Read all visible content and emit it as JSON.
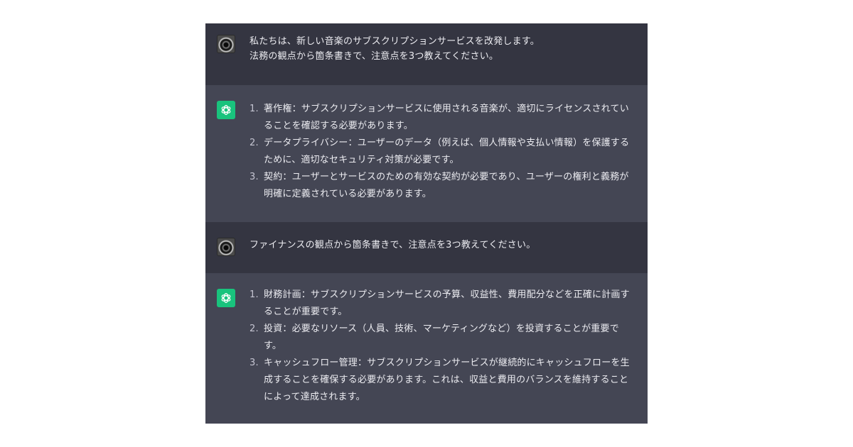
{
  "conversation": [
    {
      "role": "user",
      "avatar_icon": "user-avatar-icon",
      "lines": [
        "私たちは、新しい音楽のサブスクリプションサービスを改発します。",
        "法務の観点から箇条書きで、注意点を3つ教えてください。"
      ]
    },
    {
      "role": "assistant",
      "avatar_icon": "openai-logo-icon",
      "items": [
        {
          "num": "1.",
          "lines": [
            "著作権：サブスクリプションサービスに使用される音楽が、適切にライセンスされてい",
            "ることを確認する必要があります。"
          ]
        },
        {
          "num": "2.",
          "lines": [
            "データプライバシー：ユーザーのデータ（例えば、個人情報や支払い情報）を保護する",
            "ために、適切なセキュリティ対策が必要です。"
          ]
        },
        {
          "num": "3.",
          "lines": [
            "契約：ユーザーとサービスのための有効な契約が必要であり、ユーザーの権利と義務が",
            "明確に定義されている必要があります。"
          ]
        }
      ]
    },
    {
      "role": "user",
      "avatar_icon": "user-avatar-icon",
      "lines": [
        "ファイナンスの観点から箇条書きで、注意点を3つ教えてください。"
      ]
    },
    {
      "role": "assistant",
      "avatar_icon": "openai-logo-icon",
      "items": [
        {
          "num": "1.",
          "lines": [
            "財務計画：サブスクリプションサービスの予算、収益性、費用配分などを正確に計画す",
            "ることが重要です。"
          ]
        },
        {
          "num": "2.",
          "lines": [
            "投資：必要なリソース（人員、技術、マーケティングなど）を投資することが重要で",
            "す。"
          ]
        },
        {
          "num": "3.",
          "lines": [
            "キャッシュフロー管理：サブスクリプションサービスが継続的にキャッシュフローを生",
            "成することを確保する必要があります。これは、収益と費用のバランスを維持すること",
            "によって達成されます。"
          ]
        }
      ]
    }
  ],
  "colors": {
    "user_bg": "#343541",
    "assistant_bg": "#444654",
    "text": "#ececf1",
    "brand": "#19c37d"
  }
}
